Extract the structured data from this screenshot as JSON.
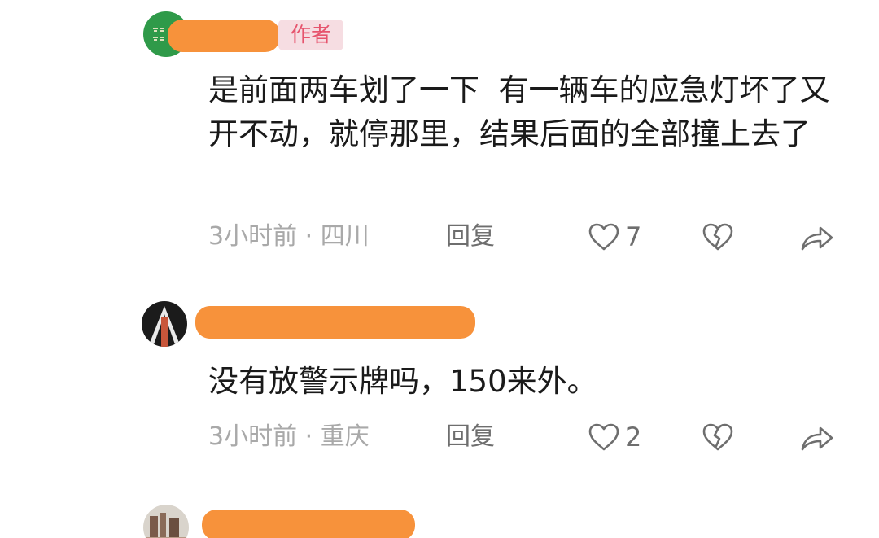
{
  "comments": [
    {
      "author_badge": "作者",
      "text": "是前面两车划了一下  有一辆车的应急灯坏了又开不动，就停那里，结果后面的全部撞上去了",
      "time_location": "3小时前 · 四川",
      "reply_label": "回复",
      "like_count": "7"
    },
    {
      "text": "没有放警示牌吗，150来外。",
      "time_location": "3小时前 · 重庆",
      "reply_label": "回复",
      "like_count": "2"
    }
  ],
  "colors": {
    "redaction": "#f7923b",
    "badge_bg": "#f6dde2",
    "badge_text": "#e6546d",
    "icon_gray": "#6e6e6e"
  },
  "icons": [
    "heart-icon",
    "broken-heart-icon",
    "share-arrow-icon"
  ]
}
